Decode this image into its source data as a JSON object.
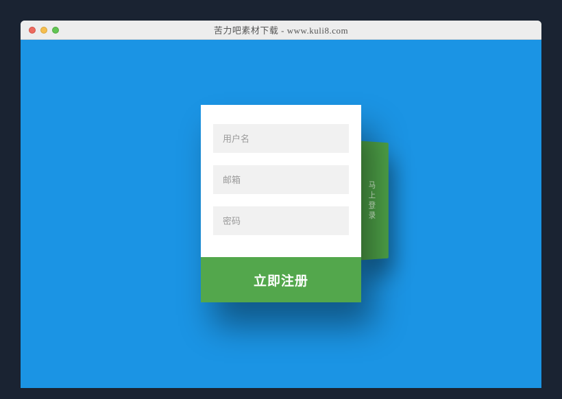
{
  "window": {
    "title": "苦力吧素材下载 - www.kuli8.com"
  },
  "side_tab": {
    "label": "马上登录"
  },
  "form": {
    "username_placeholder": "用户名",
    "email_placeholder": "邮箱",
    "password_placeholder": "密码",
    "submit_label": "立即注册"
  }
}
